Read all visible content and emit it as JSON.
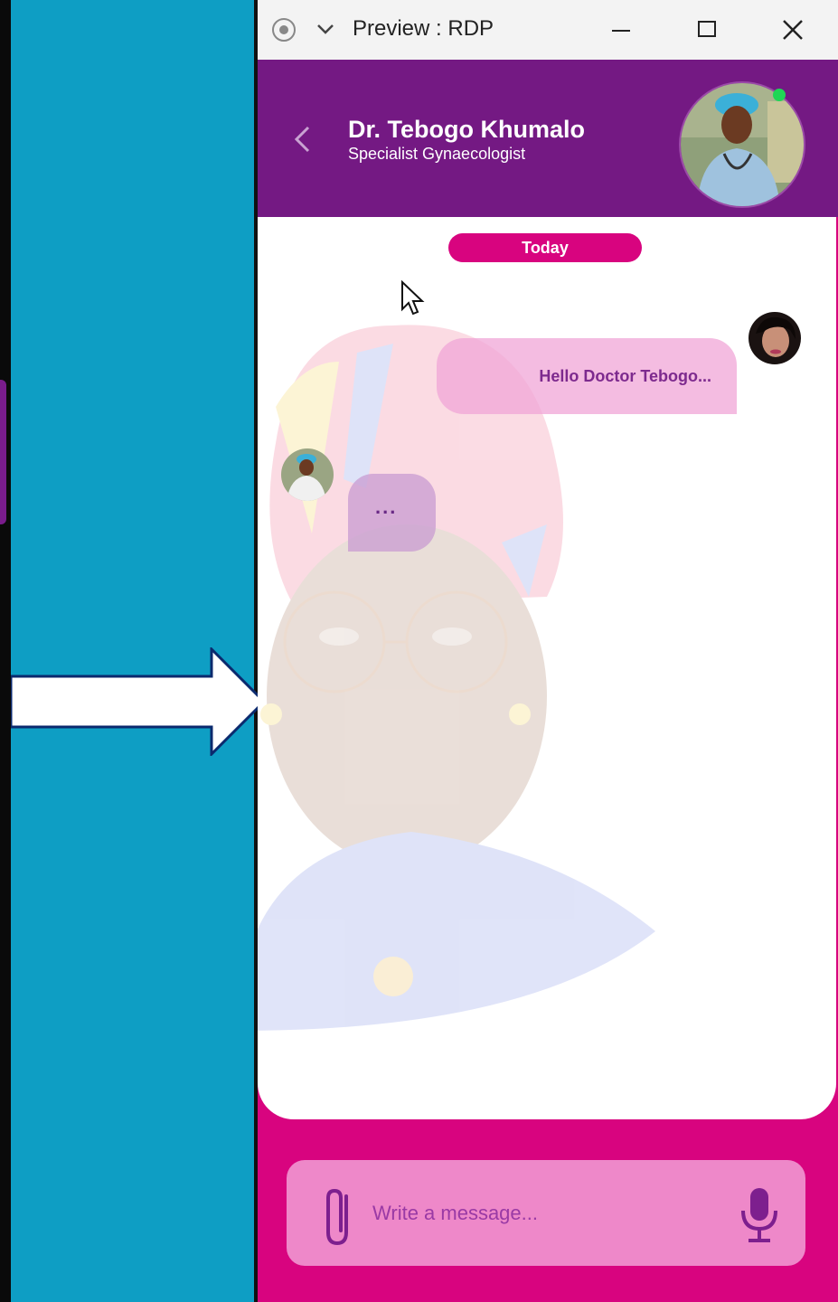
{
  "window": {
    "title": "Preview : RDP"
  },
  "header": {
    "doctor_name": "Dr. Tebogo Khumalo",
    "doctor_title": "Specialist Gynaecologist",
    "online": true
  },
  "chat": {
    "date_label": "Today",
    "messages": [
      {
        "from": "user",
        "text": "Hello Doctor Tebogo..."
      },
      {
        "from": "doctor",
        "text": "..."
      }
    ]
  },
  "composer": {
    "placeholder": "Write a message..."
  },
  "colors": {
    "header": "#741983",
    "accent": "#d8047f",
    "composer": "#ee88c9",
    "sidebar": "#0e9ec4",
    "online": "#1fd655"
  },
  "icons": [
    "record-icon",
    "chevron-down-icon",
    "minimize-icon",
    "maximize-icon",
    "close-icon",
    "back-chevron-icon",
    "paperclip-icon",
    "microphone-icon",
    "cursor-icon",
    "arrow-right-icon"
  ]
}
